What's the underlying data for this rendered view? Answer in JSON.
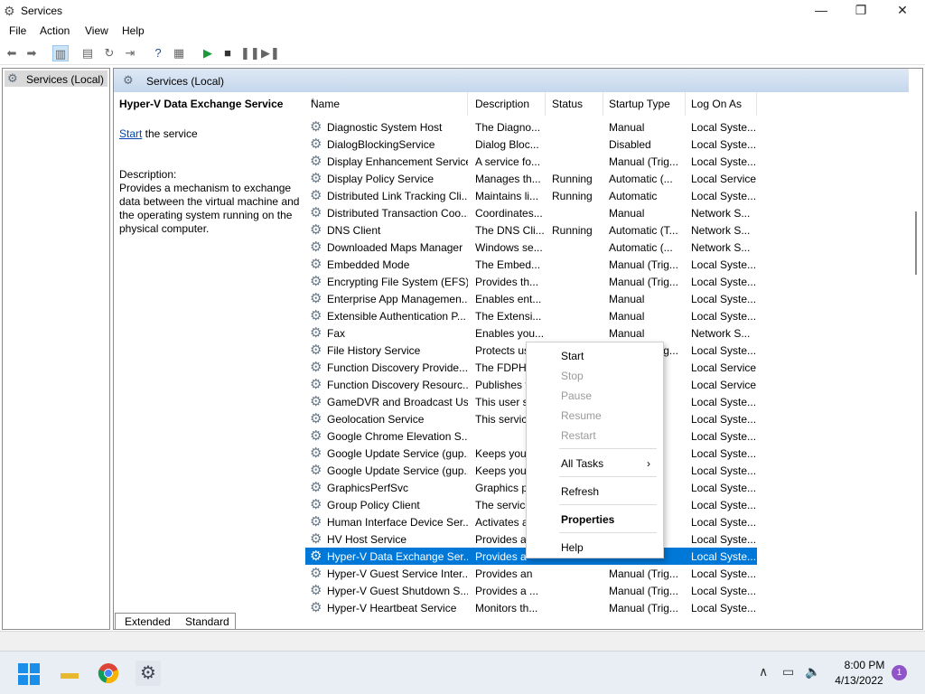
{
  "window": {
    "title": "Services",
    "minimize_glyph": "—",
    "maximize_glyph": "❐",
    "close_glyph": "✕"
  },
  "menubar": [
    "File",
    "Action",
    "View",
    "Help"
  ],
  "toolbar": {
    "icons": [
      "back-icon",
      "forward-icon",
      "show-hide-console-tree-icon",
      "properties-icon",
      "refresh-icon",
      "export-list-icon",
      "help-icon",
      "show-action-pane-icon",
      "start-service-icon",
      "stop-service-icon",
      "pause-service-icon",
      "resume-service-icon"
    ]
  },
  "tree": {
    "root_label": "Services (Local)"
  },
  "pane": {
    "header": "Services (Local)",
    "selected_service": "Hyper-V Data Exchange Service",
    "start_link": "Start",
    "start_suffix": " the service",
    "description_label": "Description:",
    "description_text": "Provides a mechanism to exchange data between the virtual machine and the operating system running on the physical computer."
  },
  "columns": [
    "Name",
    "Description",
    "Status",
    "Startup Type",
    "Log On As"
  ],
  "services": [
    {
      "name": "Diagnostic System Host",
      "desc": "The Diagno...",
      "status": "",
      "startup": "Manual",
      "logon": "Local Syste..."
    },
    {
      "name": "DialogBlockingService",
      "desc": "Dialog Bloc...",
      "status": "",
      "startup": "Disabled",
      "logon": "Local Syste..."
    },
    {
      "name": "Display Enhancement Service",
      "desc": "A service fo...",
      "status": "",
      "startup": "Manual (Trig...",
      "logon": "Local Syste..."
    },
    {
      "name": "Display Policy Service",
      "desc": "Manages th...",
      "status": "Running",
      "startup": "Automatic (...",
      "logon": "Local Service"
    },
    {
      "name": "Distributed Link Tracking Cli...",
      "desc": "Maintains li...",
      "status": "Running",
      "startup": "Automatic",
      "logon": "Local Syste..."
    },
    {
      "name": "Distributed Transaction Coo...",
      "desc": "Coordinates...",
      "status": "",
      "startup": "Manual",
      "logon": "Network S..."
    },
    {
      "name": "DNS Client",
      "desc": "The DNS Cli...",
      "status": "Running",
      "startup": "Automatic (T...",
      "logon": "Network S..."
    },
    {
      "name": "Downloaded Maps Manager",
      "desc": "Windows se...",
      "status": "",
      "startup": "Automatic (...",
      "logon": "Network S..."
    },
    {
      "name": "Embedded Mode",
      "desc": "The Embed...",
      "status": "",
      "startup": "Manual (Trig...",
      "logon": "Local Syste..."
    },
    {
      "name": "Encrypting File System (EFS)",
      "desc": "Provides th...",
      "status": "",
      "startup": "Manual (Trig...",
      "logon": "Local Syste..."
    },
    {
      "name": "Enterprise App Managemen...",
      "desc": "Enables ent...",
      "status": "",
      "startup": "Manual",
      "logon": "Local Syste..."
    },
    {
      "name": "Extensible Authentication P...",
      "desc": "The Extensi...",
      "status": "",
      "startup": "Manual",
      "logon": "Local Syste..."
    },
    {
      "name": "Fax",
      "desc": "Enables you...",
      "status": "",
      "startup": "Manual",
      "logon": "Network S..."
    },
    {
      "name": "File History Service",
      "desc": "Protects us",
      "status": "",
      "startup": "Manual (Trig...",
      "logon": "Local Syste..."
    },
    {
      "name": "Function Discovery Provide...",
      "desc": "The FDPHC",
      "status": "",
      "startup": "",
      "logon": "Local Service"
    },
    {
      "name": "Function Discovery Resourc...",
      "desc": "Publishes t",
      "status": "",
      "startup": "",
      "logon": "Local Service"
    },
    {
      "name": "GameDVR and Broadcast Us...",
      "desc": "This user se",
      "status": "",
      "startup": "",
      "logon": "Local Syste..."
    },
    {
      "name": "Geolocation Service",
      "desc": "This service",
      "status": "",
      "startup": "",
      "logon": "Local Syste..."
    },
    {
      "name": "Google Chrome Elevation S...",
      "desc": "",
      "status": "",
      "startup": "",
      "logon": "Local Syste..."
    },
    {
      "name": "Google Update Service (gup...",
      "desc": "Keeps your",
      "status": "",
      "startup": "",
      "logon": "Local Syste..."
    },
    {
      "name": "Google Update Service (gup...",
      "desc": "Keeps your",
      "status": "",
      "startup": "",
      "logon": "Local Syste..."
    },
    {
      "name": "GraphicsPerfSvc",
      "desc": "Graphics p",
      "status": "",
      "startup": "",
      "logon": "Local Syste..."
    },
    {
      "name": "Group Policy Client",
      "desc": "The service",
      "status": "",
      "startup": "",
      "logon": "Local Syste..."
    },
    {
      "name": "Human Interface Device Ser...",
      "desc": "Activates a",
      "status": "",
      "startup": "",
      "logon": "Local Syste..."
    },
    {
      "name": "HV Host Service",
      "desc": "Provides ar",
      "status": "",
      "startup": "",
      "logon": "Local Syste..."
    },
    {
      "name": "Hyper-V Data Exchange Ser...",
      "desc": "Provides a",
      "status": "",
      "startup": "",
      "logon": "Local Syste...",
      "selected": true
    },
    {
      "name": "Hyper-V Guest Service Inter...",
      "desc": "Provides an",
      "status": "",
      "startup": "Manual (Trig...",
      "logon": "Local Syste..."
    },
    {
      "name": "Hyper-V Guest Shutdown S...",
      "desc": "Provides a ...",
      "status": "",
      "startup": "Manual (Trig...",
      "logon": "Local Syste..."
    },
    {
      "name": "Hyper-V Heartbeat Service",
      "desc": "Monitors th...",
      "status": "",
      "startup": "Manual (Trig...",
      "logon": "Local Syste..."
    }
  ],
  "context_menu": {
    "start": "Start",
    "stop": "Stop",
    "pause": "Pause",
    "resume": "Resume",
    "restart": "Restart",
    "all_tasks": "All Tasks",
    "refresh": "Refresh",
    "properties": "Properties",
    "help": "Help"
  },
  "tabs": [
    "Extended",
    "Standard"
  ],
  "taskbar": {
    "apps": [
      "start-icon",
      "file-explorer-icon",
      "chrome-icon",
      "services-icon"
    ],
    "time": "8:00 PM",
    "date": "4/13/2022",
    "notification_count": "1"
  }
}
